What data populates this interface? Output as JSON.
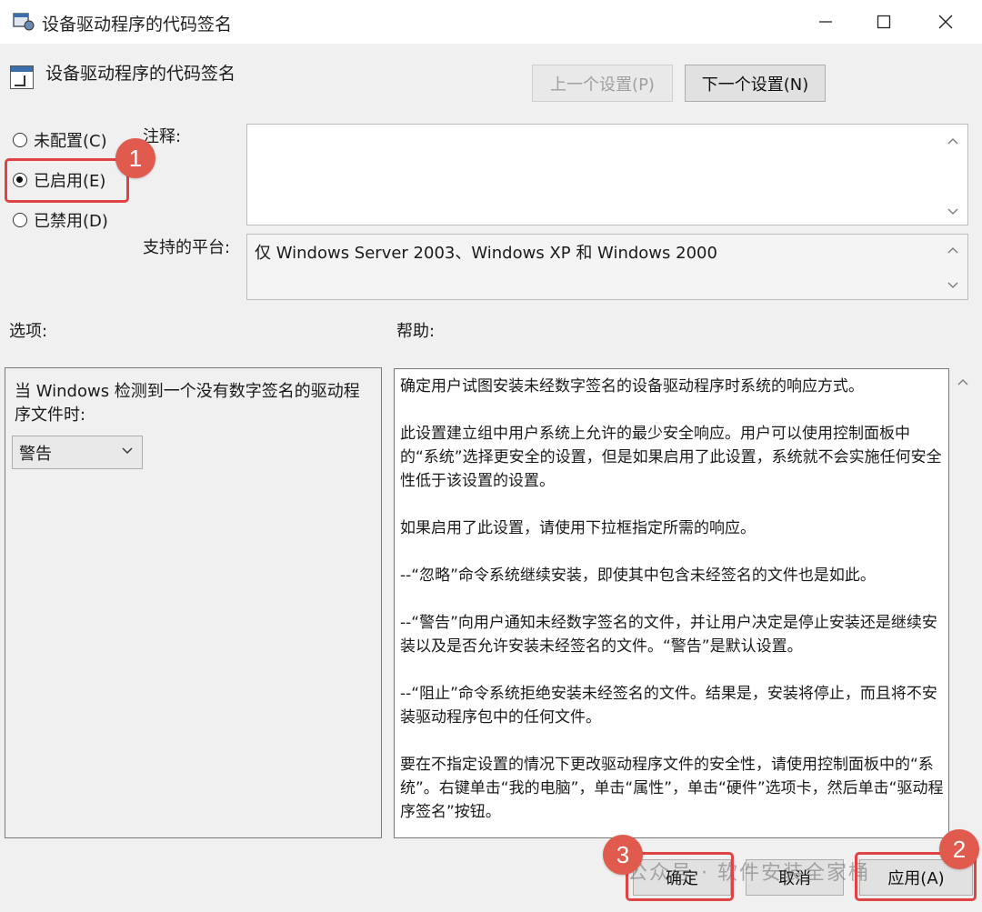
{
  "window": {
    "title": "设备驱动程序的代码签名",
    "minimize_icon": "minimize-icon",
    "maximize_icon": "maximize-icon",
    "close_icon": "close-icon"
  },
  "header": {
    "policy_name": "设备驱动程序的代码签名",
    "prev_button": "上一个设置(P)",
    "next_button": "下一个设置(N)"
  },
  "state": {
    "options": [
      {
        "label": "未配置(C)",
        "checked": false
      },
      {
        "label": "已启用(E)",
        "checked": true
      },
      {
        "label": "已禁用(D)",
        "checked": false
      }
    ]
  },
  "comment": {
    "label": "注释:",
    "value": ""
  },
  "platform": {
    "label": "支持的平台:",
    "value": "仅 Windows Server 2003、Windows XP 和 Windows 2000"
  },
  "options_section": {
    "label": "选项:",
    "prompt": "当 Windows 检测到一个没有数字签名的驱动程序文件时:",
    "dropdown_value": "警告"
  },
  "help_section": {
    "label": "帮助:",
    "paragraphs": [
      "确定用户试图安装未经数字签名的设备驱动程序时系统的响应方式。",
      "此设置建立组中用户系统上允许的最少安全响应。用户可以使用控制面板中的“系统”选择更安全的设置，但是如果启用了此设置，系统就不会实施任何安全性低于该设置的设置。",
      "如果启用了此设置，请使用下拉框指定所需的响应。",
      "--“忽略”命令系统继续安装，即使其中包含未经签名的文件也是如此。",
      "--“警告”向用户通知未经数字签名的文件，并让用户决定是停止安装还是继续安装以及是否允许安装未经签名的文件。“警告”是默认设置。",
      "--“阻止”命令系统拒绝安装未经签名的文件。结果是，安装将停止，而且将不安装驱动程序包中的任何文件。",
      "要在不指定设置的情况下更改驱动程序文件的安全性，请使用控制面板中的“系统”。右键单击“我的电脑”，单击“属性”，单击“硬件”选项卡，然后单击“驱动程序签名”按钮。"
    ]
  },
  "footer": {
    "ok_button": "确定",
    "cancel_button": "取消",
    "apply_button": "应用(A)"
  },
  "annotations": {
    "marker_1": "1",
    "marker_2": "2",
    "marker_3": "3",
    "highlight_color": "#e04343",
    "watermark": "公众号 · 软件安装全家桶"
  }
}
